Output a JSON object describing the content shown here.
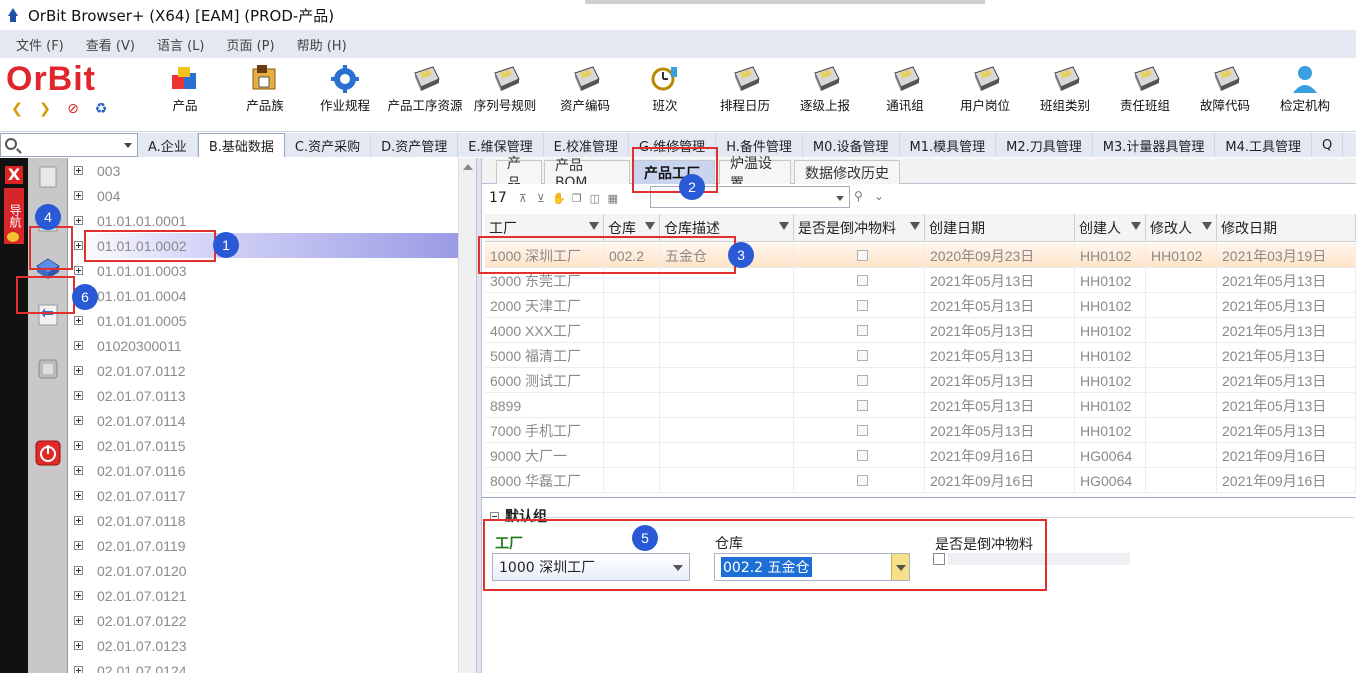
{
  "window": {
    "title": "OrBit Browser+ (X64) [EAM] (PROD-产品)"
  },
  "menu": [
    "文件 (F)",
    "查看 (V)",
    "语言 (L)",
    "页面 (P)",
    "帮助 (H)"
  ],
  "logo": "OrBit",
  "toolbar_buttons": [
    "产品",
    "产品族",
    "作业规程",
    "产品工序资源",
    "序列号规则",
    "资产编码",
    "班次",
    "排程日历",
    "逐级上报",
    "通讯组",
    "用户岗位",
    "班组类别",
    "责任班组",
    "故障代码",
    "检定机构"
  ],
  "search": {
    "value": ""
  },
  "module_tabs": [
    "A.企业",
    "B.基础数据",
    "C.资产采购",
    "D.资产管理",
    "E.维保管理",
    "E.校准管理",
    "G.维修管理",
    "H.备件管理",
    "M0.设备管理",
    "M1.模具管理",
    "M2.刀具管理",
    "M3.计量器具管理",
    "M4.工具管理",
    "Q"
  ],
  "active_module_tab": "B.基础数据",
  "left_strip": {
    "label": "导航"
  },
  "tree": {
    "items": [
      "003",
      "004",
      "01.01.01.0001",
      "01.01.01.0002",
      "01.01.01.0003",
      "01.01.01.0004",
      "01.01.01.0005",
      "01020300011",
      "02.01.07.0112",
      "02.01.07.0113",
      "02.01.07.0114",
      "02.01.07.0115",
      "02.01.07.0116",
      "02.01.07.0117",
      "02.01.07.0118",
      "02.01.07.0119",
      "02.01.07.0120",
      "02.01.07.0121",
      "02.01.07.0122",
      "02.01.07.0123",
      "02.01.07.0124"
    ],
    "selected_index": 3
  },
  "sub_tabs": [
    "产品",
    "产品 BOM",
    "产品工厂",
    "炉温设置",
    "数据修改历史"
  ],
  "active_sub_tab": "产品工厂",
  "grid": {
    "record_count": "17",
    "columns": [
      "工厂",
      "仓库",
      "仓库描述",
      "是否是倒冲物料",
      "创建日期",
      "创建人",
      "修改人",
      "修改日期"
    ],
    "rows": [
      [
        "1000 深圳工厂",
        "002.2",
        "五金仓",
        "",
        "2020年09月23日",
        "HH0102",
        "HH0102",
        "2021年03月19日"
      ],
      [
        "3000 东莞工厂",
        "",
        "",
        "",
        "2021年05月13日",
        "HH0102",
        "",
        "2021年05月13日"
      ],
      [
        "2000 天津工厂",
        "",
        "",
        "",
        "2021年05月13日",
        "HH0102",
        "",
        "2021年05月13日"
      ],
      [
        "4000 XXX工厂",
        "",
        "",
        "",
        "2021年05月13日",
        "HH0102",
        "",
        "2021年05月13日"
      ],
      [
        "5000 福清工厂",
        "",
        "",
        "",
        "2021年05月13日",
        "HH0102",
        "",
        "2021年05月13日"
      ],
      [
        "6000 测试工厂",
        "",
        "",
        "",
        "2021年05月13日",
        "HH0102",
        "",
        "2021年05月13日"
      ],
      [
        "8899",
        "",
        "",
        "",
        "2021年05月13日",
        "HH0102",
        "",
        "2021年05月13日"
      ],
      [
        "7000 手机工厂",
        "",
        "",
        "",
        "2021年05月13日",
        "HH0102",
        "",
        "2021年05月13日"
      ],
      [
        "9000 大厂一",
        "",
        "",
        "",
        "2021年09月16日",
        "HG0064",
        "",
        "2021年09月16日"
      ],
      [
        "8000 华磊工厂",
        "",
        "",
        "",
        "2021年09月16日",
        "HG0064",
        "",
        "2021年09月16日"
      ]
    ],
    "selected_row": 0
  },
  "form": {
    "group_title": "默认组",
    "factory_label": "工厂",
    "factory_value": "1000 深圳工厂",
    "warehouse_label": "仓库",
    "warehouse_value": "002.2 五金仓",
    "backflush_label": "是否是倒冲物料"
  },
  "annotations": [
    "1",
    "2",
    "3",
    "4",
    "5",
    "6"
  ],
  "colors": {
    "accent_red": "#e0302f",
    "badge_blue": "#2a59d6",
    "logo_red": "#e0262c"
  }
}
